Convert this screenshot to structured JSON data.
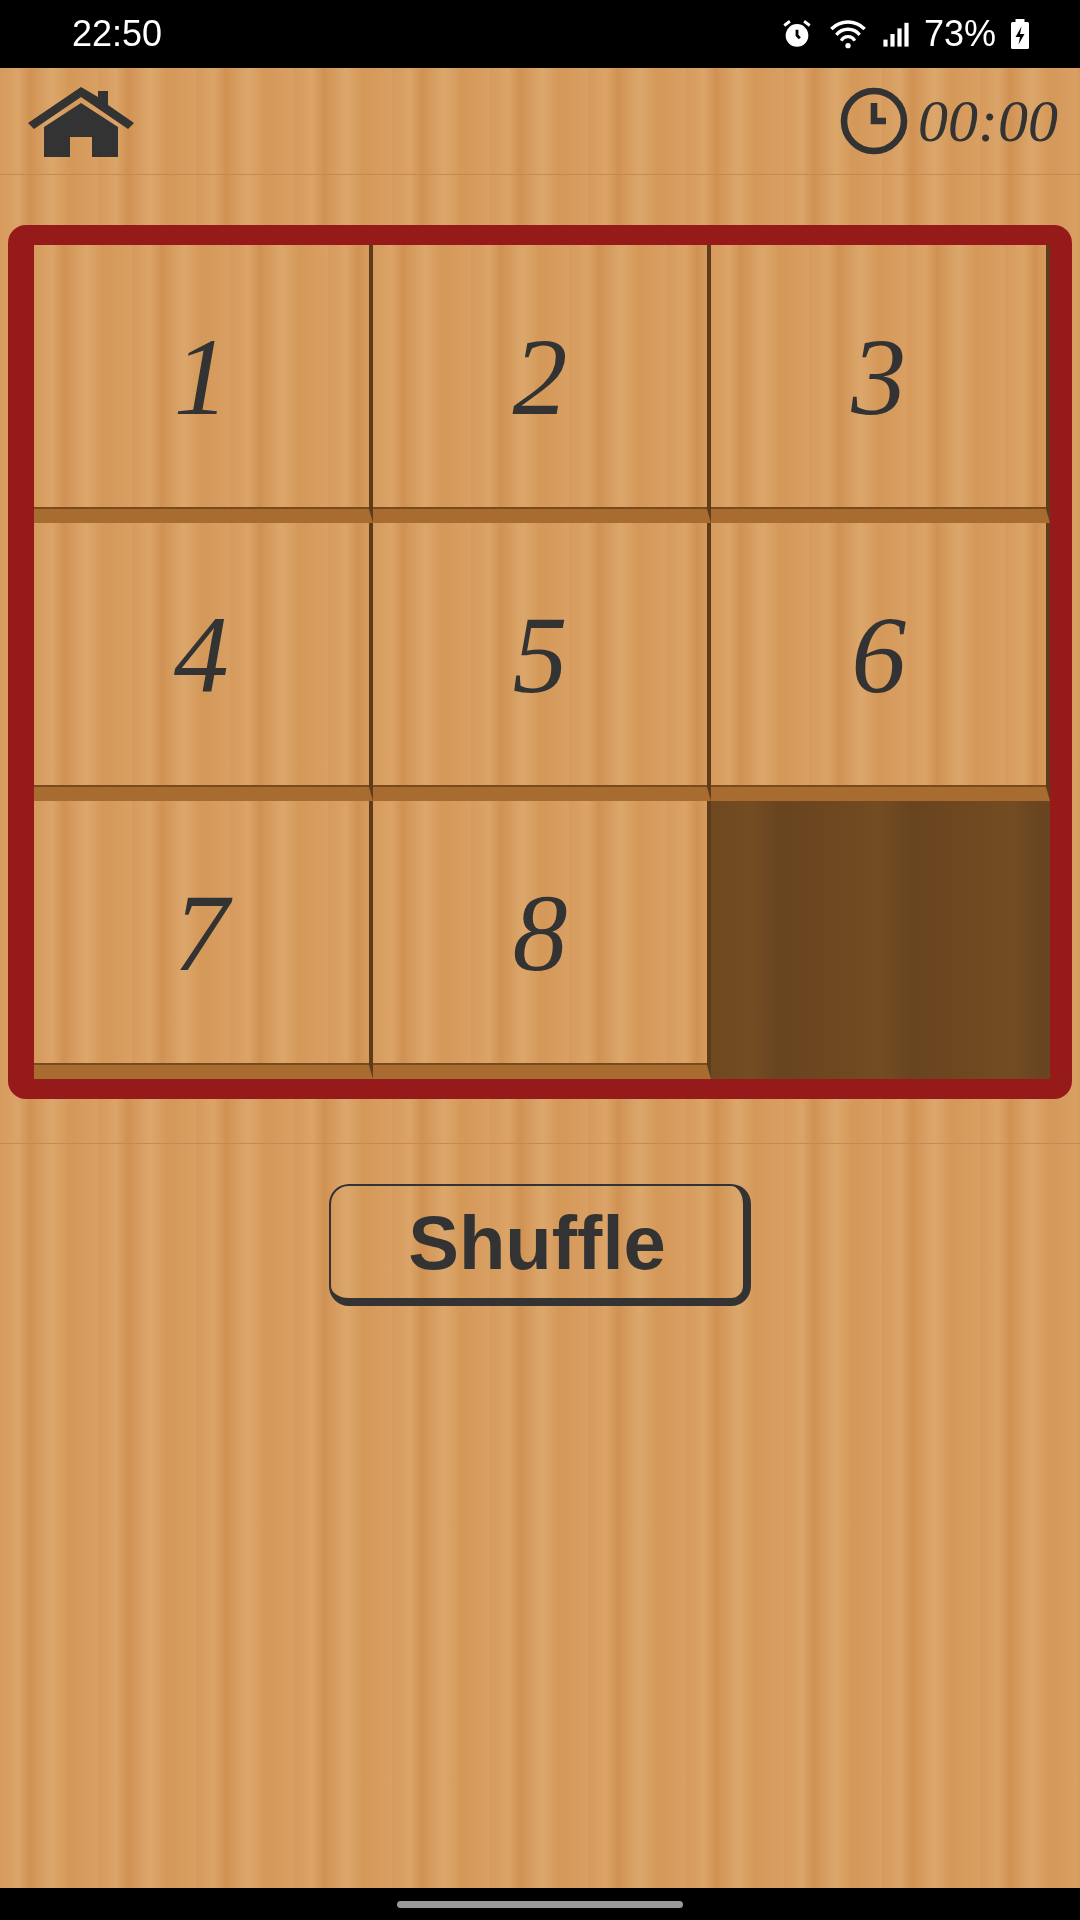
{
  "status_bar": {
    "time": "22:50",
    "battery": "73%"
  },
  "header": {
    "timer": "00:00"
  },
  "board": {
    "tiles": [
      {
        "kind": "number",
        "label": "1"
      },
      {
        "kind": "number",
        "label": "2"
      },
      {
        "kind": "number",
        "label": "3"
      },
      {
        "kind": "number",
        "label": "4"
      },
      {
        "kind": "number",
        "label": "5"
      },
      {
        "kind": "number",
        "label": "6"
      },
      {
        "kind": "number",
        "label": "7"
      },
      {
        "kind": "number",
        "label": "8"
      },
      {
        "kind": "empty"
      }
    ]
  },
  "buttons": [
    {
      "label": "Shuffle"
    }
  ]
}
